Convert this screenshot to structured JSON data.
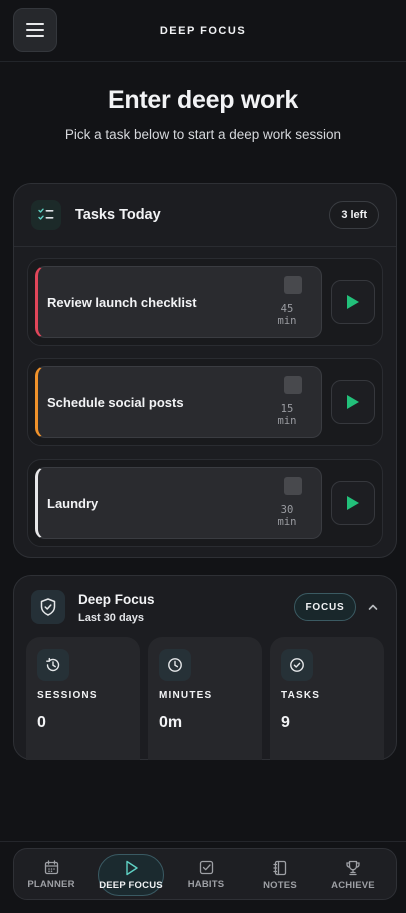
{
  "header": {
    "title": "DEEP FOCUS",
    "menu_icon": "hamburger-icon"
  },
  "hero": {
    "title": "Enter deep work",
    "subtitle": "Pick a task below to start a deep work session"
  },
  "tasks_card": {
    "title": "Tasks Today",
    "remaining_label": "3 left",
    "tasks": [
      {
        "name": "Review launch checklist",
        "duration": "45",
        "unit": "min",
        "accent": "#e0465a"
      },
      {
        "name": "Schedule social posts",
        "duration": "15",
        "unit": "min",
        "accent": "#f0922b"
      },
      {
        "name": "Laundry",
        "duration": "30",
        "unit": "min",
        "accent": "#e8e8ea"
      }
    ],
    "play_color": "#22c07a"
  },
  "focus_card": {
    "title": "Deep Focus",
    "subtitle": "Last 30 days",
    "badge": "FOCUS",
    "stats": [
      {
        "label": "SESSIONS",
        "value": "0",
        "icon": "history-icon"
      },
      {
        "label": "MINUTES",
        "value": "0m",
        "icon": "clock-icon"
      },
      {
        "label": "TASKS",
        "value": "9",
        "icon": "check-circle-icon"
      }
    ]
  },
  "nav": {
    "items": [
      {
        "label": "PLANNER",
        "icon": "calendar-icon",
        "active": false
      },
      {
        "label": "DEEP FOCUS",
        "icon": "play-icon",
        "active": true
      },
      {
        "label": "HABITS",
        "icon": "check-square-icon",
        "active": false
      },
      {
        "label": "NOTES",
        "icon": "notebook-icon",
        "active": false
      },
      {
        "label": "ACHIEVE",
        "icon": "trophy-icon",
        "active": false
      }
    ]
  },
  "colors": {
    "accent_teal": "#5fd1c4",
    "background": "#121316"
  }
}
